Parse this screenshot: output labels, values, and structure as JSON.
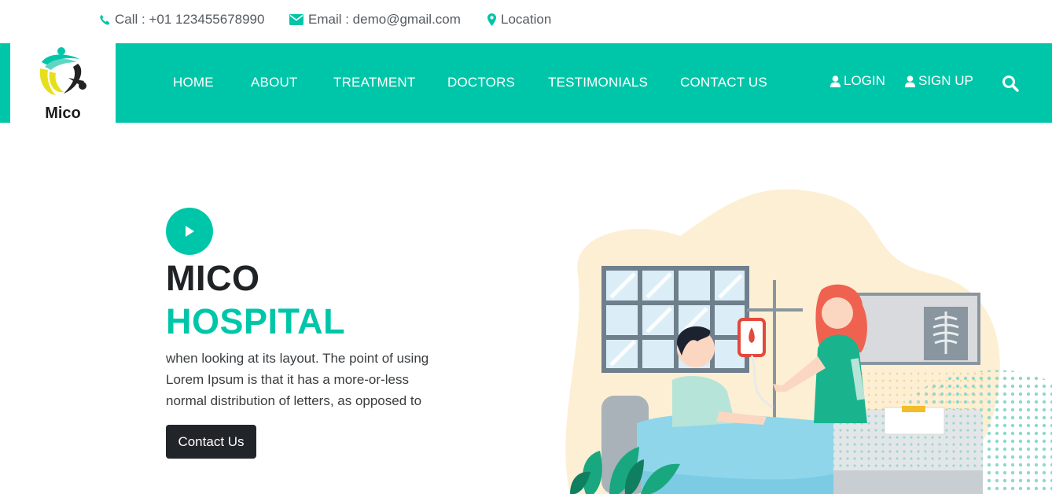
{
  "contact_bar": {
    "call": "Call : +01 123455678990",
    "email": "Email : demo@gmail.com",
    "location": "Location"
  },
  "brand": {
    "name": "Mico"
  },
  "nav": {
    "items": [
      {
        "label": "HOME"
      },
      {
        "label": "ABOUT"
      },
      {
        "label": "TREATMENT"
      },
      {
        "label": "DOCTORS"
      },
      {
        "label": "TESTIMONIALS"
      },
      {
        "label": "CONTACT US"
      }
    ],
    "login": "LOGIN",
    "signup": "SIGN UP",
    "search_icon": "search-icon"
  },
  "hero": {
    "title_line1": "MICO",
    "title_line2": "HOSPITAL",
    "text_lines": [
      "when looking at its layout. The point of using",
      "Lorem Ipsum is that it has a more-or-less",
      "normal distribution of letters, as opposed to"
    ],
    "cta": "Contact Us",
    "play_icon": "play-icon"
  },
  "colors": {
    "accent": "#00c6a9",
    "dark": "#212529",
    "text": "#555a60"
  }
}
